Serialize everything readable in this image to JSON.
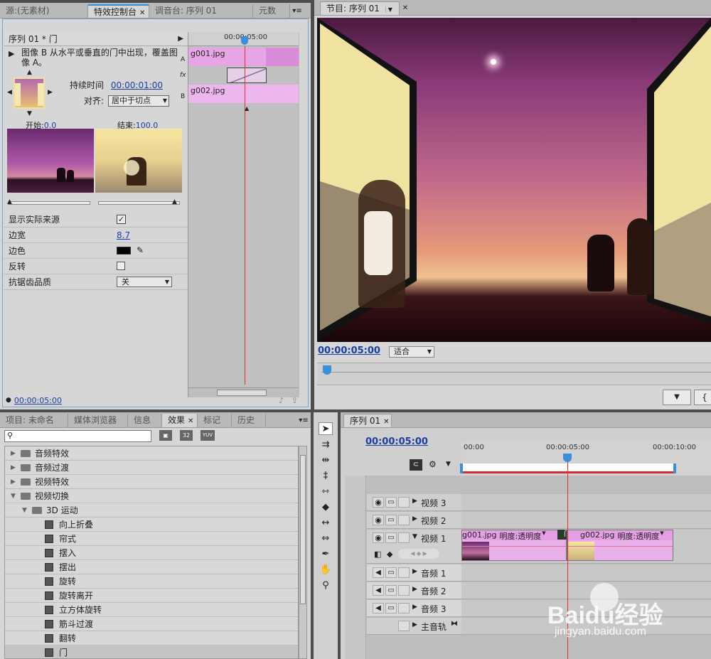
{
  "source_panel": {
    "tabs": [
      "源:(无素材)",
      "特效控制台",
      "调音台: 序列 01",
      "元数"
    ],
    "sequence_name": "序列 01 * 门",
    "description": "图像 B 从水平或垂直的门中出现，覆盖图像 A。",
    "duration_label": "持续时间",
    "duration_value": "00:00:01:00",
    "align_label": "对齐:",
    "align_value": "居中于切点",
    "start_label": "开始:",
    "start_value": "0.0",
    "end_label": "结束:",
    "end_value": "100.0",
    "params": [
      {
        "label": "显示实际来源",
        "value": "checked"
      },
      {
        "label": "边宽",
        "value": "8.7"
      },
      {
        "label": "边色",
        "value": ""
      },
      {
        "label": "反转",
        "value": ""
      },
      {
        "label": "抗锯齿品质",
        "value": "关"
      }
    ],
    "mini_timeline": {
      "ruler_time": "00:00:05:00",
      "clip_a": "g001.jpg",
      "clip_b": "g002.jpg",
      "track_a_label": "A",
      "track_b_label": "B",
      "fx_label": "fx"
    },
    "footer_time": "00:00:05:00"
  },
  "program_panel": {
    "tab": "节目: 序列 01",
    "timecode": "00:00:05:00",
    "fit_label": "适合"
  },
  "effects_panel": {
    "tabs": [
      "项目: 未命名",
      "媒体浏览器",
      "信息",
      "效果",
      "标记",
      "历史"
    ],
    "search_placeholder": "",
    "badges": [
      "32",
      "YUV"
    ],
    "tree": [
      {
        "label": "音频特效",
        "level": 0,
        "type": "folder",
        "open": false
      },
      {
        "label": "音频过渡",
        "level": 0,
        "type": "folder",
        "open": false
      },
      {
        "label": "视频特效",
        "level": 0,
        "type": "folder",
        "open": false
      },
      {
        "label": "视频切换",
        "level": 0,
        "type": "folder",
        "open": true
      },
      {
        "label": "3D 运动",
        "level": 1,
        "type": "folder",
        "open": true
      },
      {
        "label": "向上折叠",
        "level": 2,
        "type": "fx"
      },
      {
        "label": "帘式",
        "level": 2,
        "type": "fx"
      },
      {
        "label": "摆入",
        "level": 2,
        "type": "fx"
      },
      {
        "label": "摆出",
        "level": 2,
        "type": "fx"
      },
      {
        "label": "旋转",
        "level": 2,
        "type": "fx"
      },
      {
        "label": "旋转离开",
        "level": 2,
        "type": "fx"
      },
      {
        "label": "立方体旋转",
        "level": 2,
        "type": "fx"
      },
      {
        "label": "筋斗过渡",
        "level": 2,
        "type": "fx"
      },
      {
        "label": "翻转",
        "level": 2,
        "type": "fx"
      },
      {
        "label": "门",
        "level": 2,
        "type": "fx",
        "selected": true
      }
    ]
  },
  "timeline_panel": {
    "tab": "序列 01",
    "timecode": "00:00:05:00",
    "ruler": [
      "00:00",
      "00:00:05:00",
      "00:00:10:00"
    ],
    "tracks": [
      {
        "name": "视频 3",
        "kind": "video"
      },
      {
        "name": "视频 2",
        "kind": "video"
      },
      {
        "name": "视频 1",
        "kind": "video",
        "expanded": true
      },
      {
        "name": "音频 1",
        "kind": "audio"
      },
      {
        "name": "音频 2",
        "kind": "audio"
      },
      {
        "name": "音频 3",
        "kind": "audio"
      },
      {
        "name": "主音轨",
        "kind": "master"
      }
    ],
    "clip1_label": "g001.jpg",
    "clip1_effect": "明度:透明度",
    "transition_label": "门",
    "clip2_label": "g002.jpg",
    "clip2_effect": "明度:透明度"
  },
  "watermark": {
    "brand": "Baidu经验",
    "url": "jingyan.baidu.com"
  },
  "colors": {
    "accent_blue": "#1b3ea6",
    "clip_pink": "#e9b0e9",
    "playhead": "#e03030"
  }
}
